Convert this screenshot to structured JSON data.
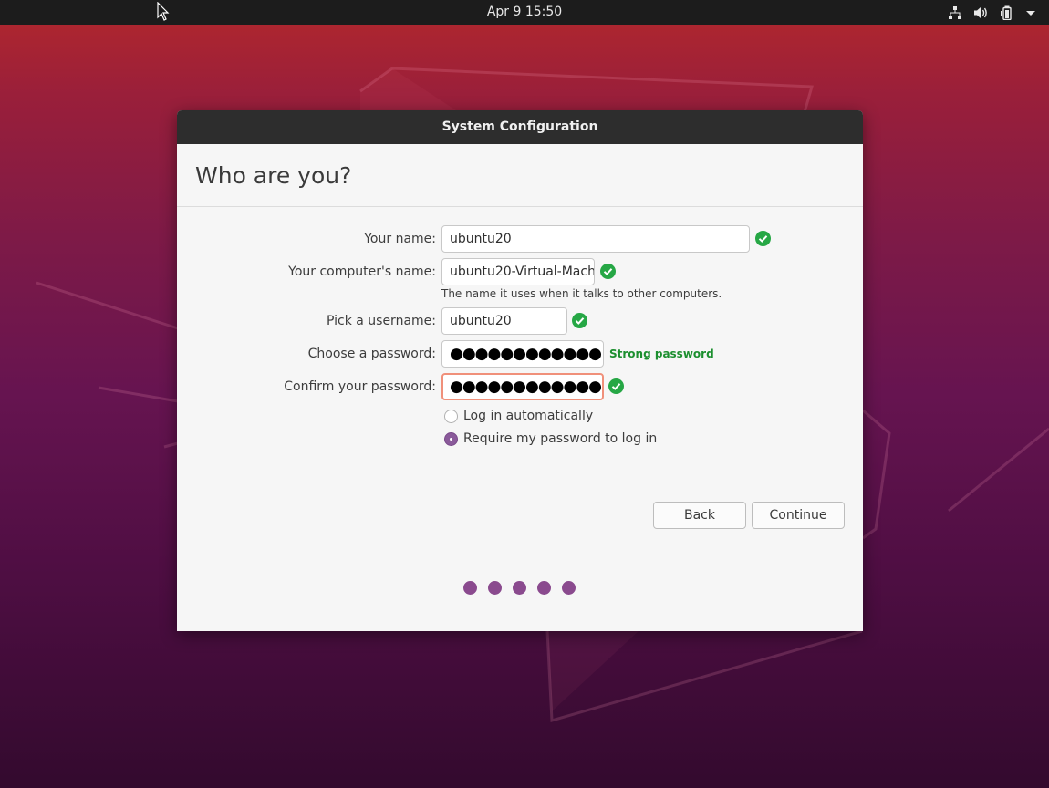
{
  "topbar": {
    "clock": "Apr 9  15:50",
    "icons": [
      "network-icon",
      "volume-icon",
      "battery-icon",
      "system-menu-arrow-icon"
    ]
  },
  "dialog": {
    "title": "System Configuration",
    "heading": "Who are you?",
    "fields": {
      "name": {
        "label": "Your name:",
        "value": "ubuntu20"
      },
      "computer": {
        "label": "Your computer's name:",
        "value": "ubuntu20-Virtual-Mach",
        "hint": "The name it uses when it talks to other computers."
      },
      "username": {
        "label": "Pick a username:",
        "value": "ubuntu20"
      },
      "password": {
        "label": "Choose a password:",
        "value": "●●●●●●●●●●●●",
        "strength": "Strong password"
      },
      "confirm": {
        "label": "Confirm your password:",
        "value": "●●●●●●●●●●●●"
      }
    },
    "login_options": {
      "auto": {
        "label": "Log in automatically",
        "selected": false
      },
      "require": {
        "label": "Require my password to log in",
        "selected": true
      }
    },
    "buttons": {
      "back": "Back",
      "continue": "Continue"
    },
    "progress_step_count": 5
  },
  "colors": {
    "valid": "#26a745",
    "accent": "#8a4a8e",
    "focus_border": "#f0907a"
  }
}
